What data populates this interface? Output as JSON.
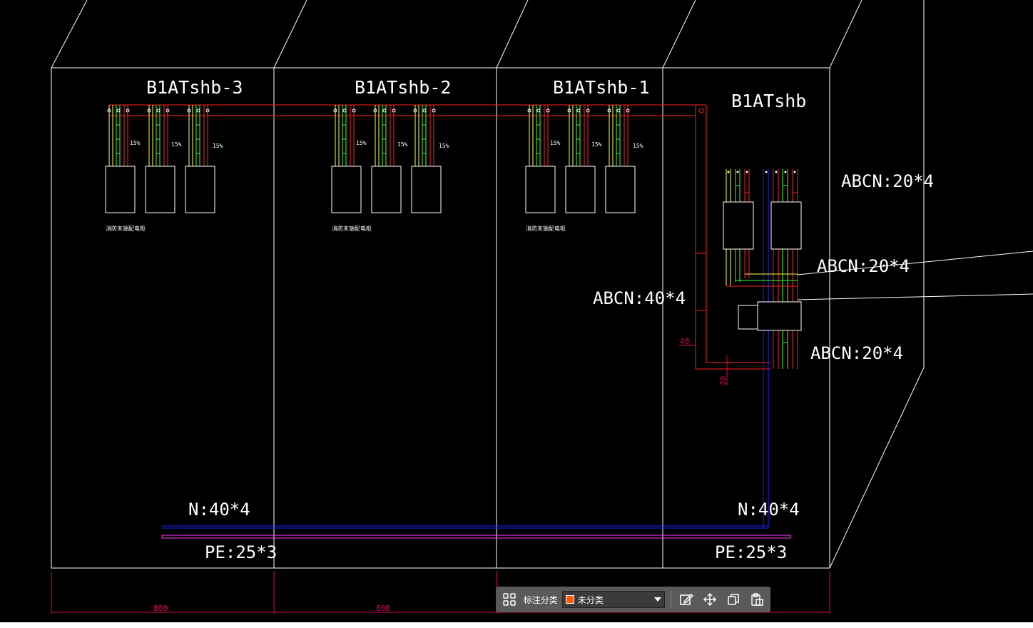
{
  "panels": [
    {
      "id": "p3",
      "label": "B1ATshb-3"
    },
    {
      "id": "p2",
      "label": "B1ATshb-2"
    },
    {
      "id": "p1",
      "label": "B1ATshb-1"
    },
    {
      "id": "p0",
      "label": "B1ATshb"
    }
  ],
  "breaker_label": "15%",
  "cable_note": "消防末端配电柜",
  "specs": {
    "abcn_top": "ABCN:20*4",
    "abcn_mid": "ABCN:20*4",
    "abcn_low": "ABCN:20*4",
    "abcn_main": "ABCN:40*4",
    "n_left": "N:40*4",
    "n_right": "N:40*4",
    "pe_left": "PE:25*3",
    "pe_right": "PE:25*3"
  },
  "dims": {
    "width_1": "800",
    "width_2": "800",
    "bus_40": "40",
    "bus_20": "20"
  },
  "toolbar": {
    "category_label": "标注分类",
    "category_value": "未分类",
    "swatch_color": "#ff5a00"
  },
  "colors": {
    "line": "#ffffff",
    "red_bus": "#ff2020",
    "yellow": "#ffff40",
    "green": "#40ff40",
    "blue": "#2020ff",
    "magenta": "#ff40ff",
    "dim": "#e00060"
  }
}
